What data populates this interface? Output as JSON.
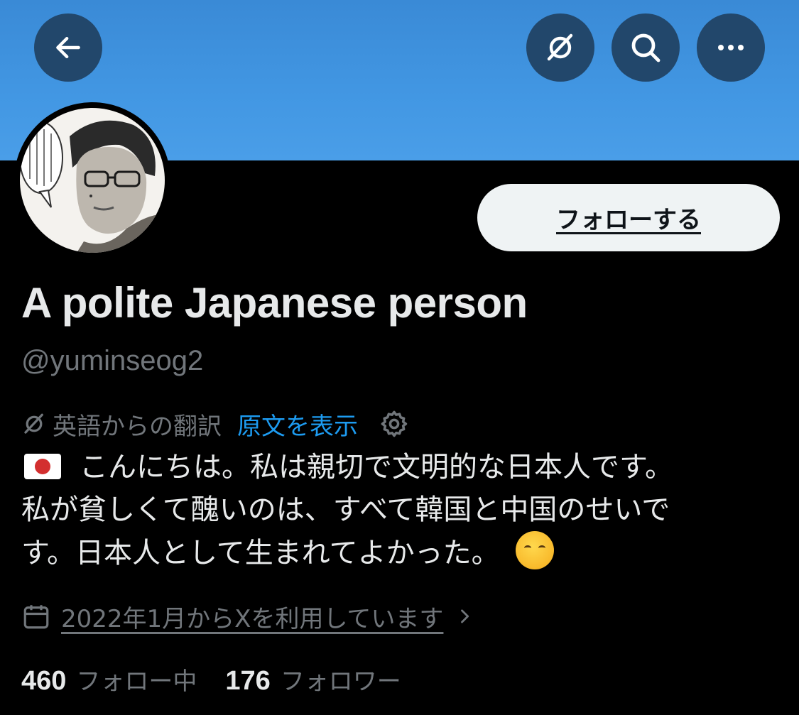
{
  "colors": {
    "banner": "#4297e3",
    "nav_button": "#22476b",
    "background": "#000000",
    "text": "#e7e9ea",
    "muted": "#71767b",
    "link": "#1d9bf0",
    "follow_button": "#eff3f4"
  },
  "nav": {
    "back_icon": "arrow-left-icon",
    "translate_icon": "translate-icon",
    "search_icon": "search-icon",
    "more_icon": "more-icon"
  },
  "profile": {
    "follow_label": "フォローする",
    "display_name": "A polite Japanese person",
    "handle": "@yuminseog2"
  },
  "translation": {
    "note": "英語からの翻訳",
    "show_original": "原文を表示"
  },
  "bio": {
    "line1": "こんにちは。私は親切で文明的な日本人です。",
    "line2": "私が貧しくて醜いのは、すべて韓国と中国のせいで",
    "line3": "す。日本人として生まれてよかった。"
  },
  "joined": {
    "text": "2022年1月からXを利用しています"
  },
  "stats": {
    "following_count": "460",
    "following_label": "フォロー中",
    "followers_count": "176",
    "followers_label": "フォロワー"
  }
}
